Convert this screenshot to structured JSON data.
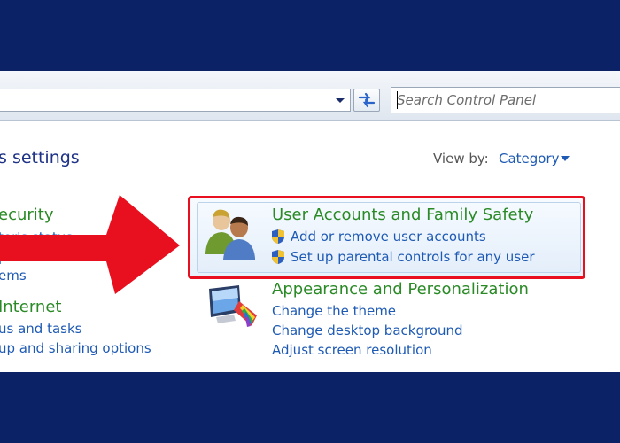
{
  "toolbar": {
    "search_placeholder": "Search Control Panel"
  },
  "page": {
    "title": "s settings",
    "view_by_label": "View by:",
    "view_by_value": "Category"
  },
  "left_categories": [
    {
      "title": "ecurity",
      "links": [
        "ter's status",
        "puter",
        "ems"
      ]
    },
    {
      "title": "Internet",
      "links": [
        "us and tasks",
        "up and sharing options"
      ]
    }
  ],
  "highlight_color": "#e8101e",
  "categories": [
    {
      "title": "User Accounts and Family Safety",
      "icon": "users-icon",
      "links": [
        "Add or remove user accounts",
        "Set up parental controls for any user"
      ]
    },
    {
      "title": "Appearance and Personalization",
      "icon": "display-appearance-icon",
      "links": [
        "Change the theme",
        "Change desktop background",
        "Adjust screen resolution"
      ]
    }
  ]
}
